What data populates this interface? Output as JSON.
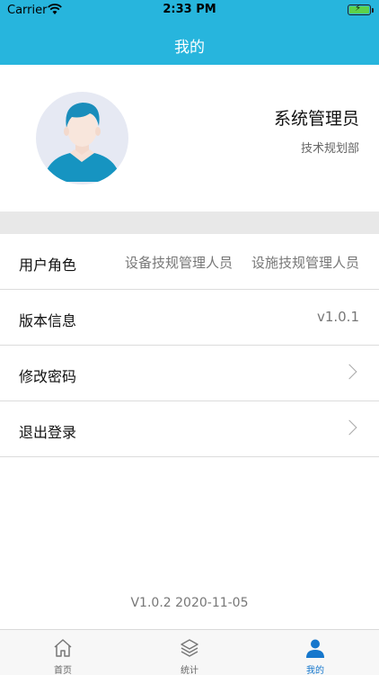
{
  "status_bar": {
    "carrier": "Carrier",
    "time": "2:33 PM"
  },
  "header": {
    "title": "我的",
    "accent_color": "#27b5dd"
  },
  "profile": {
    "name": "系统管理员",
    "department": "技术规划部"
  },
  "settings": {
    "roles_label": "用户角色",
    "roles": [
      "设备技规管理人员",
      "设施技规管理人员"
    ],
    "version_label": "版本信息",
    "version_value": "v1.0.1",
    "change_password_label": "修改密码",
    "logout_label": "退出登录"
  },
  "footer": {
    "version_text": "V1.0.2 2020-11-05"
  },
  "tabs": [
    {
      "label": "首页",
      "icon": "home-icon"
    },
    {
      "label": "统计",
      "icon": "layers-icon"
    },
    {
      "label": "我的",
      "icon": "person-icon",
      "active": true
    }
  ]
}
